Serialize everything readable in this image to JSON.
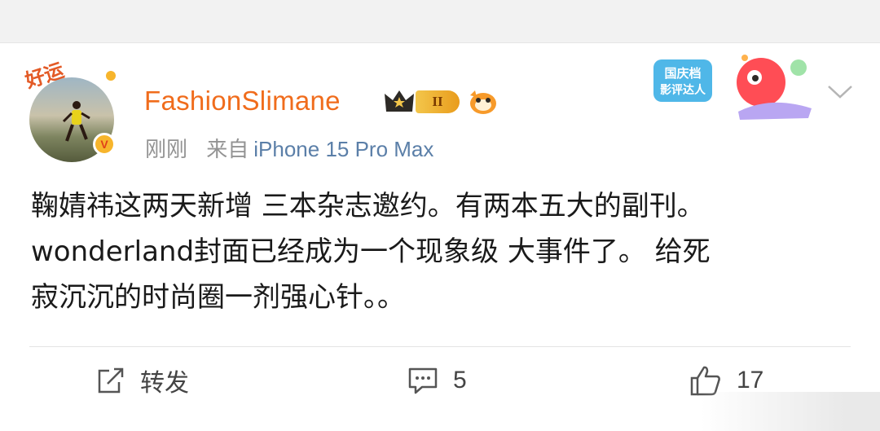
{
  "post": {
    "user": {
      "name": "FashionSlimane",
      "level": "II",
      "avatar_tag": "好运"
    },
    "time": "刚刚",
    "source_prefix": "来自",
    "source": "iPhone 15 Pro Max",
    "sticker_text_line1": "国庆档",
    "sticker_text_line2": "影评达人",
    "text_line1": "鞠婧祎这两天新增 三本杂志邀约。有两本五大的副刊。",
    "text_line2": "wonderland封面已经成为一个现象级 大事件了。 给死",
    "text_line3": "寂沉沉的时尚圈一剂强心针。。"
  },
  "actions": {
    "share_label": "转发",
    "comment_count": "5",
    "like_count": "17"
  },
  "colors": {
    "username": "#f06c1c",
    "source_link": "#5b7fa8",
    "meta": "#939393",
    "text": "#1a1a1a"
  },
  "icons": {
    "share": "share-icon",
    "comment": "comment-icon",
    "like": "like-icon",
    "more": "chevron-down-icon",
    "verified": "verified-v-icon",
    "crown": "crown-icon"
  }
}
